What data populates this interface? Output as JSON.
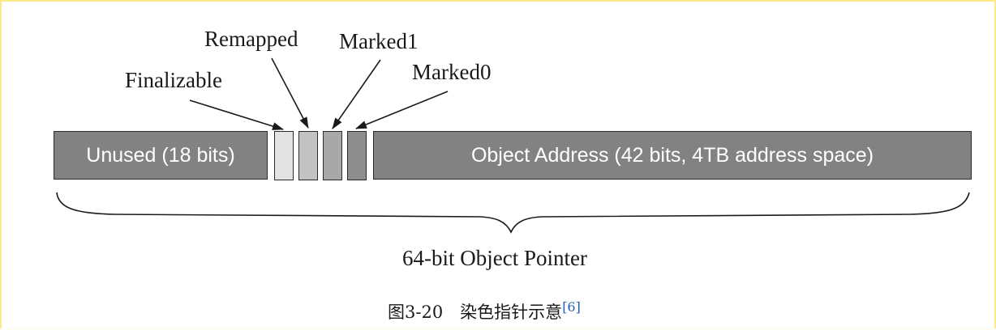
{
  "diagram": {
    "bit_labels": {
      "remapped": "Remapped",
      "marked1": "Marked1",
      "finalizable": "Finalizable",
      "marked0": "Marked0"
    },
    "segments": {
      "unused": "Unused (18 bits)",
      "object_address": "Object Address (42 bits, 4TB address space)"
    },
    "bits": [
      {
        "name": "Finalizable",
        "color": "#e3e3e3"
      },
      {
        "name": "Remapped",
        "color": "#c2c2c2"
      },
      {
        "name": "Marked1",
        "color": "#a8a8a8"
      },
      {
        "name": "Marked0",
        "color": "#8e8e8e"
      }
    ],
    "brace_label": "64-bit Object Pointer"
  },
  "caption": {
    "text": "图3-20　染色指针示意",
    "citation": "[6]"
  }
}
